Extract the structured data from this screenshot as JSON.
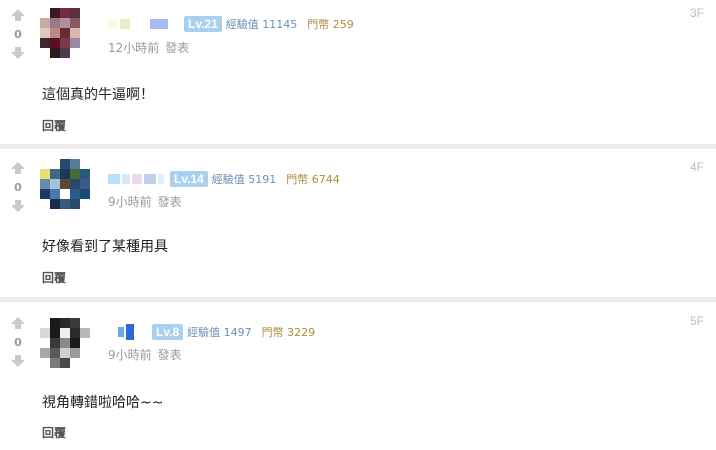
{
  "comments": [
    {
      "level": "Lv.21",
      "exp_label": "經驗值",
      "exp_value": "11145",
      "coin_label": "門幣",
      "coin_value": "259",
      "time": "12小時前",
      "post_label": "發表",
      "floor": "3F",
      "score": "0",
      "text": "這個真的牛逼啊！",
      "reply": "回覆"
    },
    {
      "level": "Lv.14",
      "exp_label": "經驗值",
      "exp_value": "5191",
      "coin_label": "門幣",
      "coin_value": "6744",
      "time": "9小時前",
      "post_label": "發表",
      "floor": "4F",
      "score": "0",
      "text": "好像看到了某種用具",
      "reply": "回覆"
    },
    {
      "level": "Lv.8",
      "exp_label": "經驗值",
      "exp_value": "1497",
      "coin_label": "門幣",
      "coin_value": "3229",
      "time": "9小時前",
      "post_label": "發表",
      "floor": "5F",
      "score": "0",
      "text": "視角轉錯啦哈哈~~",
      "reply": "回覆"
    }
  ],
  "colors": {
    "level_badge": "#a9d1ef",
    "exp_text": "#6a8fb6",
    "coin_text": "#b08a3e",
    "separator": "#ececec"
  }
}
